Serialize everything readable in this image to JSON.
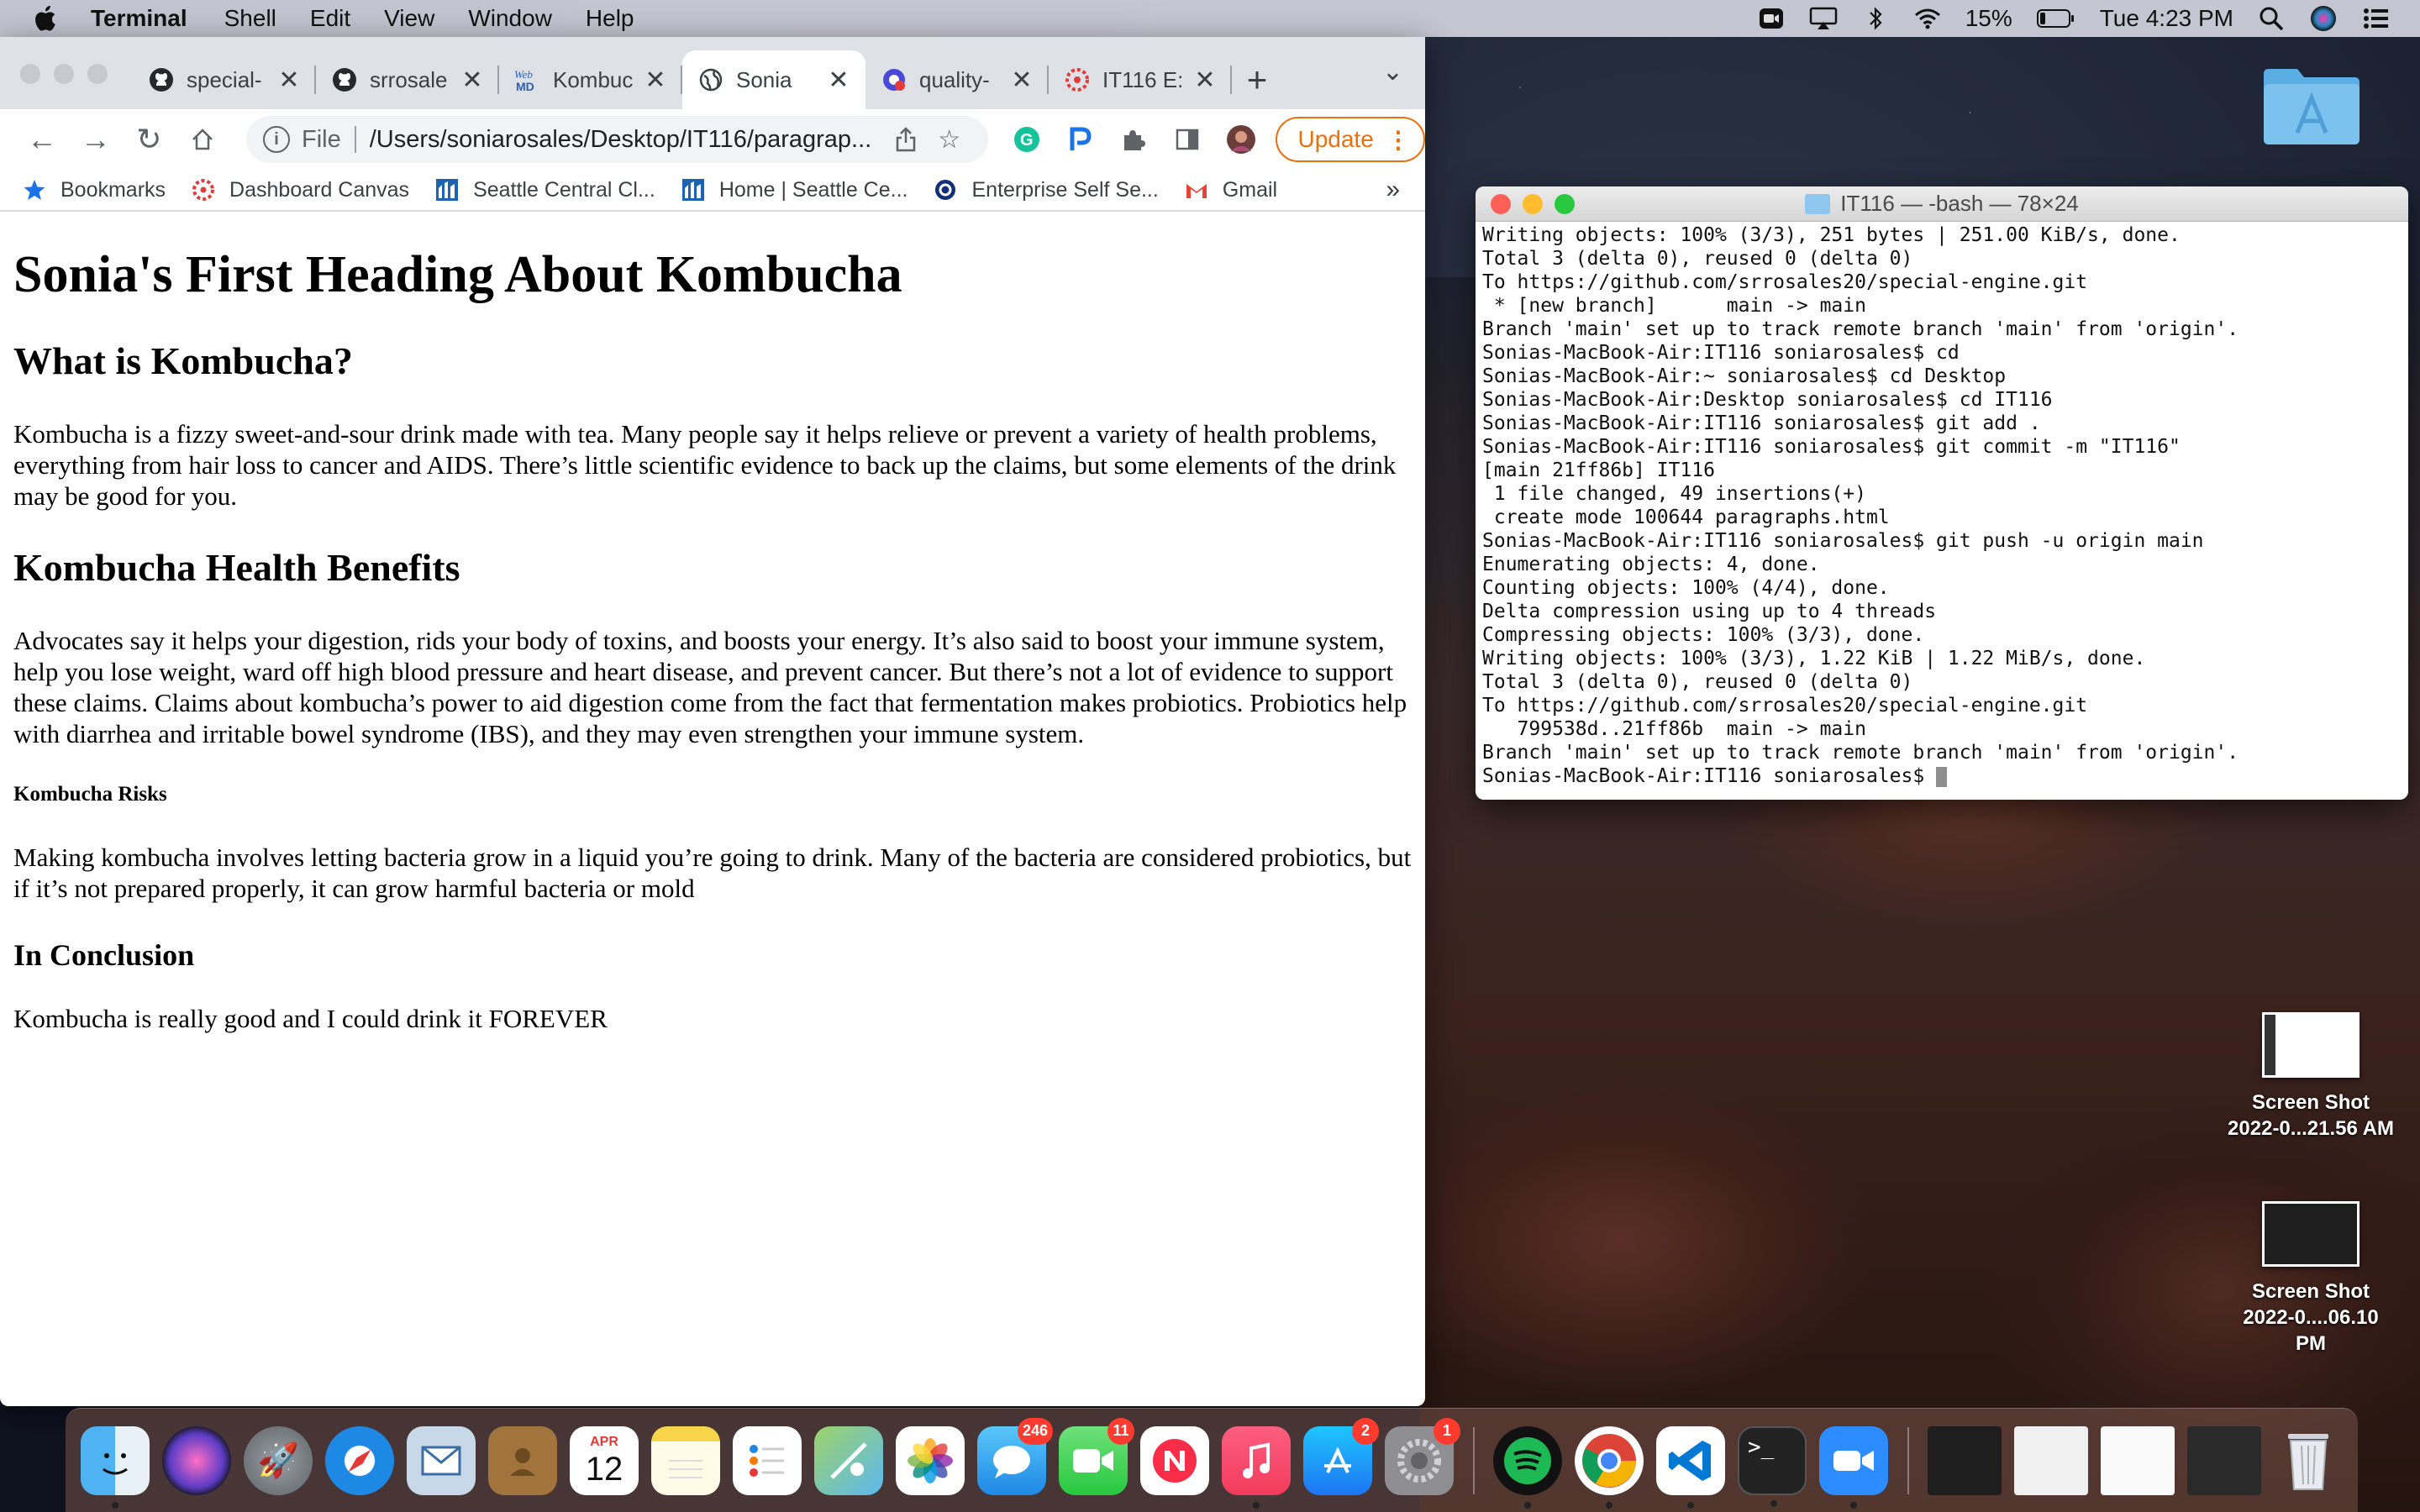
{
  "menubar": {
    "app_name": "Terminal",
    "menus": [
      "Shell",
      "Edit",
      "View",
      "Window",
      "Help"
    ],
    "battery": "15%",
    "clock": "Tue 4:23 PM"
  },
  "browser": {
    "tabs": [
      {
        "title": "special-",
        "icon": "github-icon"
      },
      {
        "title": "srrosale",
        "icon": "github-icon"
      },
      {
        "title": "Kombuc",
        "icon": "webmd-icon"
      },
      {
        "title": "Sonia",
        "icon": "globe-icon"
      },
      {
        "title": "quality-",
        "icon": "quality-icon"
      },
      {
        "title": "IT116 E:",
        "icon": "canvas-icon"
      }
    ],
    "scheme": "File",
    "url": "/Users/soniarosales/Desktop/IT116/paragrap...",
    "update_label": "Update",
    "bookmarks": [
      {
        "label": "Bookmarks"
      },
      {
        "label": "Dashboard Canvas"
      },
      {
        "label": "Seattle Central Cl..."
      },
      {
        "label": "Home | Seattle Ce..."
      },
      {
        "label": "Enterprise Self Se..."
      },
      {
        "label": "Gmail"
      }
    ],
    "bookmarks_more": "»"
  },
  "page": {
    "h1": "Sonia's First Heading About Kombucha",
    "h2_what": "What is Kombucha?",
    "p_what": "Kombucha is a fizzy sweet-and-sour drink made with tea. Many people say it helps relieve or prevent a variety of health problems, everything from hair loss to cancer and AIDS. There’s little scientific evidence to back up the claims, but some elements of the drink may be good for you.",
    "h2_benefits": "Kombucha Health Benefits",
    "p_benefits": "Advocates say it helps your digestion, rids your body of toxins, and boosts your energy. It’s also said to boost your immune system, help you lose weight, ward off high blood pressure and heart disease, and prevent cancer. But there’s not a lot of evidence to support these claims. Claims about kombucha’s power to aid digestion come from the fact that fermentation makes probiotics. Probiotics help with diarrhea and irritable bowel syndrome (IBS), and they may even strengthen your immune system.",
    "h5_risks": "Kombucha Risks",
    "p_risks": "Making kombucha involves letting bacteria grow in a liquid you’re going to drink. Many of the bacteria are considered probiotics, but if it’s not prepared properly, it can grow harmful bacteria or mold",
    "h3_conclusion": "In Conclusion",
    "p_conclusion": "Kombucha is really good and I could drink it FOREVER"
  },
  "terminal": {
    "title": "IT116 — -bash — 78×24",
    "lines": [
      "Writing objects: 100% (3/3), 251 bytes | 251.00 KiB/s, done.",
      "Total 3 (delta 0), reused 0 (delta 0)",
      "To https://github.com/srrosales20/special-engine.git",
      " * [new branch]      main -> main",
      "Branch 'main' set up to track remote branch 'main' from 'origin'.",
      "Sonias-MacBook-Air:IT116 soniarosales$ cd",
      "Sonias-MacBook-Air:~ soniarosales$ cd Desktop",
      "Sonias-MacBook-Air:Desktop soniarosales$ cd IT116",
      "Sonias-MacBook-Air:IT116 soniarosales$ git add .",
      "Sonias-MacBook-Air:IT116 soniarosales$ git commit -m \"IT116\"",
      "[main 21ff86b] IT116",
      " 1 file changed, 49 insertions(+)",
      " create mode 100644 paragraphs.html",
      "Sonias-MacBook-Air:IT116 soniarosales$ git push -u origin main",
      "Enumerating objects: 4, done.",
      "Counting objects: 100% (4/4), done.",
      "Delta compression using up to 4 threads",
      "Compressing objects: 100% (3/3), done.",
      "Writing objects: 100% (3/3), 1.22 KiB | 1.22 MiB/s, done.",
      "Total 3 (delta 0), reused 0 (delta 0)",
      "To https://github.com/srrosales20/special-engine.git",
      "   799538d..21ff86b  main -> main",
      "Branch 'main' set up to track remote branch 'main' from 'origin'."
    ],
    "prompt": "Sonias-MacBook-Air:IT116 soniarosales$ "
  },
  "desktop": {
    "screenshot1": {
      "line1": "Screen Shot",
      "line2": "2022-0...21.56 AM"
    },
    "screenshot2": {
      "line1": "Screen Shot",
      "line2": "2022-0....06.10 PM"
    }
  },
  "dock": {
    "calendar_month": "APR",
    "calendar_day": "12",
    "badges": {
      "messages": "246",
      "facetime": "11",
      "appstore": "2",
      "settings": "1"
    }
  }
}
